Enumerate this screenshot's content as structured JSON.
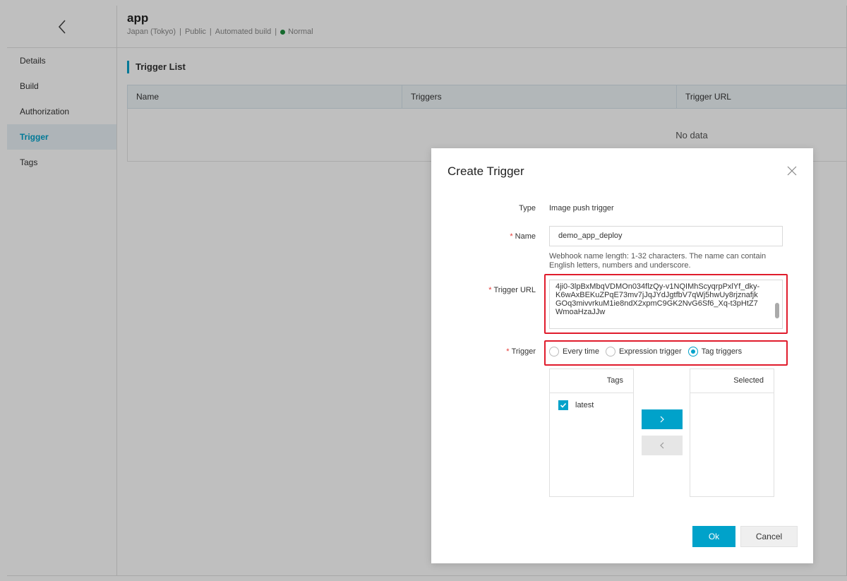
{
  "header": {
    "title": "app",
    "region": "Japan (Tokyo)",
    "visibility": "Public",
    "build_type": "Automated build",
    "status": "Normal",
    "status_color": "#1e8e3e",
    "sep": "|"
  },
  "sidebar": {
    "items": [
      {
        "label": "Details"
      },
      {
        "label": "Build"
      },
      {
        "label": "Authorization"
      },
      {
        "label": "Trigger"
      },
      {
        "label": "Tags"
      }
    ]
  },
  "main": {
    "section_title": "Trigger List",
    "table": {
      "columns": [
        "Name",
        "Triggers",
        "Trigger URL"
      ],
      "empty_text": "No data"
    }
  },
  "modal": {
    "title": "Create Trigger",
    "type_label": "Type",
    "type_value": "Image push trigger",
    "name_label": "Name",
    "name_value": "demo_app_deploy",
    "name_help": "Webhook name length: 1-32 characters. The name can contain English letters, numbers and underscore.",
    "url_label": "Trigger URL",
    "url_value": "4ji0-3lpBxMbqVDMOn034flzQy-v1NQIMhScyqrpPxlYf_dky-K6wAxBEKuZPqE73mv7jJqJYdJgtfbV7qWj5hwUy8rjznafjkGOq3mivvrkuM1ie8ndX2xpmC9GK2NvG6Sf6_Xq-t3pHtZ7WmoaHzaJJw",
    "trigger_label": "Trigger",
    "trigger_options": [
      {
        "label": "Every time",
        "checked": false
      },
      {
        "label": "Expression trigger",
        "checked": false
      },
      {
        "label": "Tag triggers",
        "checked": true
      }
    ],
    "transfer": {
      "left_title": "Tags",
      "right_title": "Selected",
      "left_items": [
        "latest"
      ]
    },
    "ok_label": "Ok",
    "cancel_label": "Cancel"
  },
  "colors": {
    "accent": "#00a2ca",
    "highlight_frame": "#e01c2c",
    "required": "#e53935"
  }
}
